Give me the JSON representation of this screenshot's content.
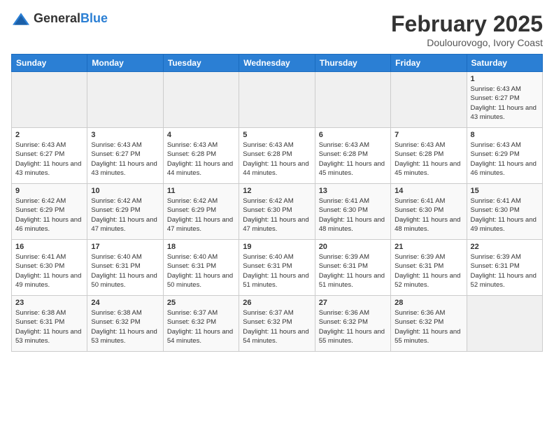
{
  "logo": {
    "text_general": "General",
    "text_blue": "Blue"
  },
  "header": {
    "month": "February 2025",
    "location": "Doulourovogo, Ivory Coast"
  },
  "weekdays": [
    "Sunday",
    "Monday",
    "Tuesday",
    "Wednesday",
    "Thursday",
    "Friday",
    "Saturday"
  ],
  "weeks": [
    [
      {
        "day": "",
        "sunrise": "",
        "sunset": "",
        "daylight": ""
      },
      {
        "day": "",
        "sunrise": "",
        "sunset": "",
        "daylight": ""
      },
      {
        "day": "",
        "sunrise": "",
        "sunset": "",
        "daylight": ""
      },
      {
        "day": "",
        "sunrise": "",
        "sunset": "",
        "daylight": ""
      },
      {
        "day": "",
        "sunrise": "",
        "sunset": "",
        "daylight": ""
      },
      {
        "day": "",
        "sunrise": "",
        "sunset": "",
        "daylight": ""
      },
      {
        "day": "1",
        "sunrise": "Sunrise: 6:43 AM",
        "sunset": "Sunset: 6:27 PM",
        "daylight": "Daylight: 11 hours and 43 minutes."
      }
    ],
    [
      {
        "day": "2",
        "sunrise": "Sunrise: 6:43 AM",
        "sunset": "Sunset: 6:27 PM",
        "daylight": "Daylight: 11 hours and 43 minutes."
      },
      {
        "day": "3",
        "sunrise": "Sunrise: 6:43 AM",
        "sunset": "Sunset: 6:27 PM",
        "daylight": "Daylight: 11 hours and 43 minutes."
      },
      {
        "day": "4",
        "sunrise": "Sunrise: 6:43 AM",
        "sunset": "Sunset: 6:28 PM",
        "daylight": "Daylight: 11 hours and 44 minutes."
      },
      {
        "day": "5",
        "sunrise": "Sunrise: 6:43 AM",
        "sunset": "Sunset: 6:28 PM",
        "daylight": "Daylight: 11 hours and 44 minutes."
      },
      {
        "day": "6",
        "sunrise": "Sunrise: 6:43 AM",
        "sunset": "Sunset: 6:28 PM",
        "daylight": "Daylight: 11 hours and 45 minutes."
      },
      {
        "day": "7",
        "sunrise": "Sunrise: 6:43 AM",
        "sunset": "Sunset: 6:28 PM",
        "daylight": "Daylight: 11 hours and 45 minutes."
      },
      {
        "day": "8",
        "sunrise": "Sunrise: 6:43 AM",
        "sunset": "Sunset: 6:29 PM",
        "daylight": "Daylight: 11 hours and 46 minutes."
      }
    ],
    [
      {
        "day": "9",
        "sunrise": "Sunrise: 6:42 AM",
        "sunset": "Sunset: 6:29 PM",
        "daylight": "Daylight: 11 hours and 46 minutes."
      },
      {
        "day": "10",
        "sunrise": "Sunrise: 6:42 AM",
        "sunset": "Sunset: 6:29 PM",
        "daylight": "Daylight: 11 hours and 47 minutes."
      },
      {
        "day": "11",
        "sunrise": "Sunrise: 6:42 AM",
        "sunset": "Sunset: 6:29 PM",
        "daylight": "Daylight: 11 hours and 47 minutes."
      },
      {
        "day": "12",
        "sunrise": "Sunrise: 6:42 AM",
        "sunset": "Sunset: 6:30 PM",
        "daylight": "Daylight: 11 hours and 47 minutes."
      },
      {
        "day": "13",
        "sunrise": "Sunrise: 6:41 AM",
        "sunset": "Sunset: 6:30 PM",
        "daylight": "Daylight: 11 hours and 48 minutes."
      },
      {
        "day": "14",
        "sunrise": "Sunrise: 6:41 AM",
        "sunset": "Sunset: 6:30 PM",
        "daylight": "Daylight: 11 hours and 48 minutes."
      },
      {
        "day": "15",
        "sunrise": "Sunrise: 6:41 AM",
        "sunset": "Sunset: 6:30 PM",
        "daylight": "Daylight: 11 hours and 49 minutes."
      }
    ],
    [
      {
        "day": "16",
        "sunrise": "Sunrise: 6:41 AM",
        "sunset": "Sunset: 6:30 PM",
        "daylight": "Daylight: 11 hours and 49 minutes."
      },
      {
        "day": "17",
        "sunrise": "Sunrise: 6:40 AM",
        "sunset": "Sunset: 6:31 PM",
        "daylight": "Daylight: 11 hours and 50 minutes."
      },
      {
        "day": "18",
        "sunrise": "Sunrise: 6:40 AM",
        "sunset": "Sunset: 6:31 PM",
        "daylight": "Daylight: 11 hours and 50 minutes."
      },
      {
        "day": "19",
        "sunrise": "Sunrise: 6:40 AM",
        "sunset": "Sunset: 6:31 PM",
        "daylight": "Daylight: 11 hours and 51 minutes."
      },
      {
        "day": "20",
        "sunrise": "Sunrise: 6:39 AM",
        "sunset": "Sunset: 6:31 PM",
        "daylight": "Daylight: 11 hours and 51 minutes."
      },
      {
        "day": "21",
        "sunrise": "Sunrise: 6:39 AM",
        "sunset": "Sunset: 6:31 PM",
        "daylight": "Daylight: 11 hours and 52 minutes."
      },
      {
        "day": "22",
        "sunrise": "Sunrise: 6:39 AM",
        "sunset": "Sunset: 6:31 PM",
        "daylight": "Daylight: 11 hours and 52 minutes."
      }
    ],
    [
      {
        "day": "23",
        "sunrise": "Sunrise: 6:38 AM",
        "sunset": "Sunset: 6:31 PM",
        "daylight": "Daylight: 11 hours and 53 minutes."
      },
      {
        "day": "24",
        "sunrise": "Sunrise: 6:38 AM",
        "sunset": "Sunset: 6:32 PM",
        "daylight": "Daylight: 11 hours and 53 minutes."
      },
      {
        "day": "25",
        "sunrise": "Sunrise: 6:37 AM",
        "sunset": "Sunset: 6:32 PM",
        "daylight": "Daylight: 11 hours and 54 minutes."
      },
      {
        "day": "26",
        "sunrise": "Sunrise: 6:37 AM",
        "sunset": "Sunset: 6:32 PM",
        "daylight": "Daylight: 11 hours and 54 minutes."
      },
      {
        "day": "27",
        "sunrise": "Sunrise: 6:36 AM",
        "sunset": "Sunset: 6:32 PM",
        "daylight": "Daylight: 11 hours and 55 minutes."
      },
      {
        "day": "28",
        "sunrise": "Sunrise: 6:36 AM",
        "sunset": "Sunset: 6:32 PM",
        "daylight": "Daylight: 11 hours and 55 minutes."
      },
      {
        "day": "",
        "sunrise": "",
        "sunset": "",
        "daylight": ""
      }
    ]
  ]
}
